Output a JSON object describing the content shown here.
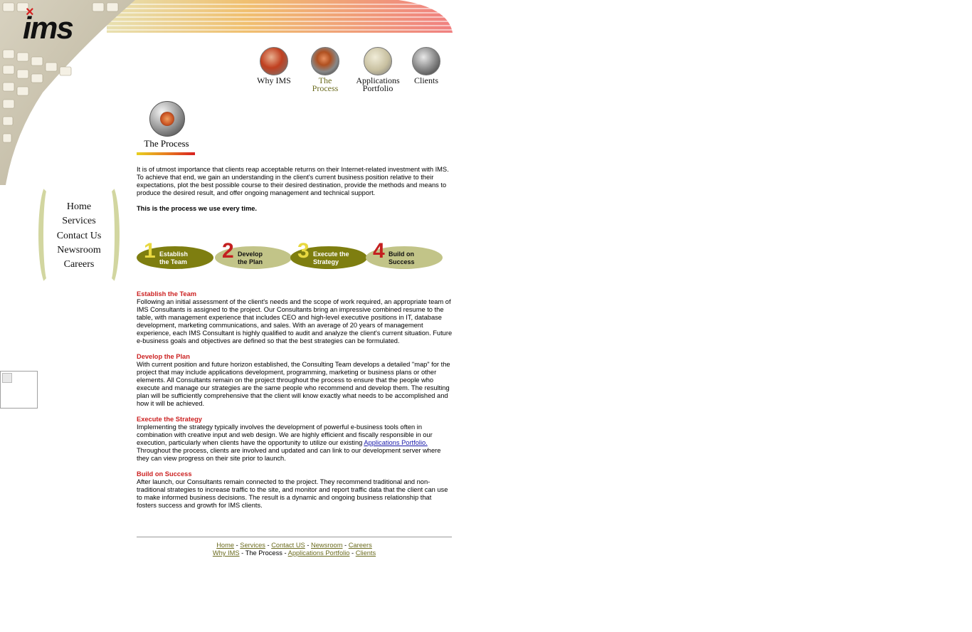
{
  "logo": {
    "text": "ims",
    "mark": "×"
  },
  "topnav": [
    {
      "label": "Why IMS",
      "icon": "chess-pieces-icon"
    },
    {
      "label": "The\nProcess",
      "icon": "gear-icon"
    },
    {
      "label": "Applications\nPortfolio",
      "icon": "binary-code-icon"
    },
    {
      "label": "Clients",
      "icon": "businessman-icon"
    }
  ],
  "page_heading": "The Process",
  "sidenav": [
    "Home",
    "Services",
    "Contact Us",
    "Newsroom",
    "Careers"
  ],
  "intro": "It is of utmost importance that clients reap acceptable returns on their Internet-related investment with IMS. To achieve that end, we gain an understanding in the client's current business position relative to their expectations, plot the best possible course to their desired destination, provide the methods and means to produce the desired result, and offer ongoing management and technical support.",
  "tagline": "This is the process we use every time.",
  "steps": [
    {
      "num": "1",
      "label": "Establish\nthe Team",
      "oval": "#7e7e10",
      "numColor": "#e8d840",
      "textColor": "#ffffff"
    },
    {
      "num": "2",
      "label": "Develop\nthe Plan",
      "oval": "#c2c488",
      "numColor": "#c42020",
      "textColor": "#111111"
    },
    {
      "num": "3",
      "label": "Execute the\nStrategy",
      "oval": "#7e7e10",
      "numColor": "#e8d840",
      "textColor": "#ffffff"
    },
    {
      "num": "4",
      "label": "Build on\nSuccess",
      "oval": "#c2c488",
      "numColor": "#c42020",
      "textColor": "#111111"
    }
  ],
  "sections": {
    "establish": {
      "title": "Establish the Team",
      "body": "Following an initial assessment of the client's needs and the scope of work required, an appropriate team of IMS Consultants is assigned to the project. Our Consultants bring an impressive combined resume to the table, with management experience that includes CEO and high-level executive positions in IT, database development, marketing communications, and sales. With an average of 20 years of management experience, each IMS Consultant is highly qualified to audit and analyze the client's current situation. Future e-business goals and objectives are defined so that the best strategies can be formulated."
    },
    "develop": {
      "title": "Develop the Plan",
      "body": "With current position and future horizon established, the Consulting Team develops a detailed \"map\" for the project that may include applications development, programming, marketing or business plans or other elements. All Consultants remain on the project throughout the process to ensure that the people who execute and manage our strategies are the same people who recommend and develop them. The resulting plan will be sufficiently comprehensive that the client will know exactly what needs to be accomplished and how it will be achieved."
    },
    "execute": {
      "title": "Execute the Strategy",
      "body_before": "Implementing the strategy typically involves the development of powerful e-business tools often in combination with creative input and web design. We are highly efficient and fiscally responsible in our execution, particularly when clients have the opportunity to utilize our existing ",
      "link": "Applications Portfolio.",
      "body_after": " Throughout the process, clients are involved and updated and can link to our development server where they can view progress on their site prior to launch."
    },
    "build": {
      "title": "Build on Success",
      "body": "After launch, our Consultants remain connected to the project. They recommend traditional and non-traditional strategies to increase traffic to the site, and monitor and report traffic data that the client can use to make informed business decisions. The result is a dynamic and ongoing business relationship that fosters success and growth for IMS clients."
    }
  },
  "footer": {
    "home": "Home",
    "services": "Services",
    "contact": "Contact US",
    "newsroom": "Newsroom",
    "careers": "Careers",
    "why": "Why IMS",
    "process": "The Process",
    "portfolio": "Applications Portfolio",
    "clients": "Clients",
    "sep": " - "
  },
  "colors": {
    "accent_red": "#cc2222",
    "olive": "#6b6b1e",
    "link_blue": "#1a1aaa"
  }
}
